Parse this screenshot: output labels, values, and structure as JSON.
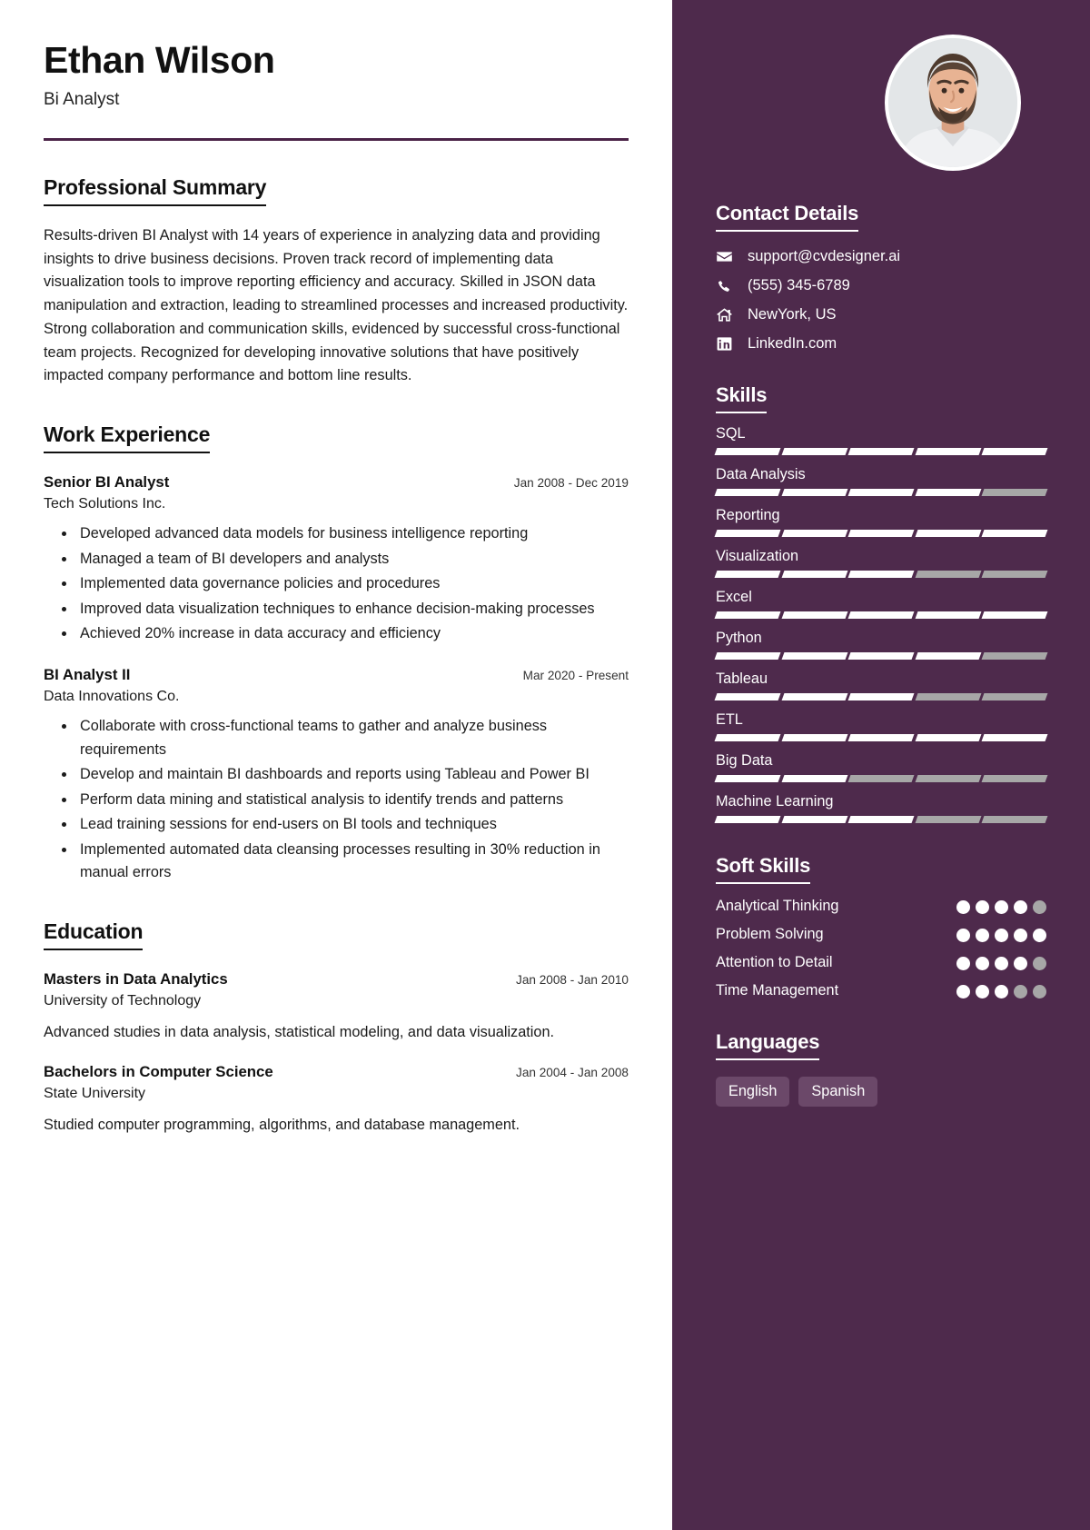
{
  "colors": {
    "sidebar_bg": "#4e2a4c",
    "accent_rule": "#4a2347",
    "chip_bg": "#6b4869",
    "bar_on": "#ffffff",
    "bar_off": "#a7a7a7"
  },
  "header": {
    "name": "Ethan Wilson",
    "job_title": "Bi Analyst"
  },
  "summary": {
    "heading": "Professional Summary",
    "text": "Results-driven BI Analyst with 14 years of experience in analyzing data and providing insights to drive business decisions. Proven track record of implementing data visualization tools to improve reporting efficiency and accuracy. Skilled in JSON data manipulation and extraction, leading to streamlined processes and increased productivity. Strong collaboration and communication skills, evidenced by successful cross-functional team projects. Recognized for developing innovative solutions that have positively impacted company performance and bottom line results."
  },
  "work": {
    "heading": "Work Experience",
    "entries": [
      {
        "title": "Senior BI Analyst",
        "date": "Jan 2008 - Dec 2019",
        "org": "Tech Solutions Inc.",
        "bullets": [
          "Developed advanced data models for business intelligence reporting",
          "Managed a team of BI developers and analysts",
          "Implemented data governance policies and procedures",
          "Improved data visualization techniques to enhance decision-making processes",
          "Achieved 20% increase in data accuracy and efficiency"
        ]
      },
      {
        "title": "BI Analyst II",
        "date": "Mar 2020 - Present",
        "org": "Data Innovations Co.",
        "bullets": [
          "Collaborate with cross-functional teams to gather and analyze business requirements",
          "Develop and maintain BI dashboards and reports using Tableau and Power BI",
          "Perform data mining and statistical analysis to identify trends and patterns",
          "Lead training sessions for end-users on BI tools and techniques",
          "Implemented automated data cleansing processes resulting in 30% reduction in manual errors"
        ]
      }
    ]
  },
  "education": {
    "heading": "Education",
    "entries": [
      {
        "title": "Masters in Data Analytics",
        "date": "Jan 2008 - Jan 2010",
        "org": "University of Technology",
        "desc": "Advanced studies in data analysis, statistical modeling, and data visualization."
      },
      {
        "title": "Bachelors in Computer Science",
        "date": "Jan 2004 - Jan 2008",
        "org": "State University",
        "desc": "Studied computer programming, algorithms, and database management."
      }
    ]
  },
  "contact": {
    "heading": "Contact Details",
    "items": [
      {
        "icon": "envelope-icon",
        "value": "support@cvdesigner.ai"
      },
      {
        "icon": "phone-icon",
        "value": "(555) 345-6789"
      },
      {
        "icon": "home-icon",
        "value": "NewYork, US"
      },
      {
        "icon": "linkedin-icon",
        "value": "LinkedIn.com"
      }
    ]
  },
  "skills": {
    "heading": "Skills",
    "segments_total": 5,
    "items": [
      {
        "name": "SQL",
        "filled": 5
      },
      {
        "name": "Data Analysis",
        "filled": 4
      },
      {
        "name": "Reporting",
        "filled": 5
      },
      {
        "name": "Visualization",
        "filled": 3
      },
      {
        "name": "Excel",
        "filled": 5
      },
      {
        "name": "Python",
        "filled": 4
      },
      {
        "name": "Tableau",
        "filled": 3
      },
      {
        "name": "ETL",
        "filled": 5
      },
      {
        "name": "Big Data",
        "filled": 2
      },
      {
        "name": "Machine Learning",
        "filled": 3
      }
    ]
  },
  "soft_skills": {
    "heading": "Soft Skills",
    "dots_total": 5,
    "items": [
      {
        "name": "Analytical Thinking",
        "filled": 4
      },
      {
        "name": "Problem Solving",
        "filled": 5
      },
      {
        "name": "Attention to Detail",
        "filled": 4
      },
      {
        "name": "Time Management",
        "filled": 3
      }
    ]
  },
  "languages": {
    "heading": "Languages",
    "items": [
      "English",
      "Spanish"
    ]
  }
}
